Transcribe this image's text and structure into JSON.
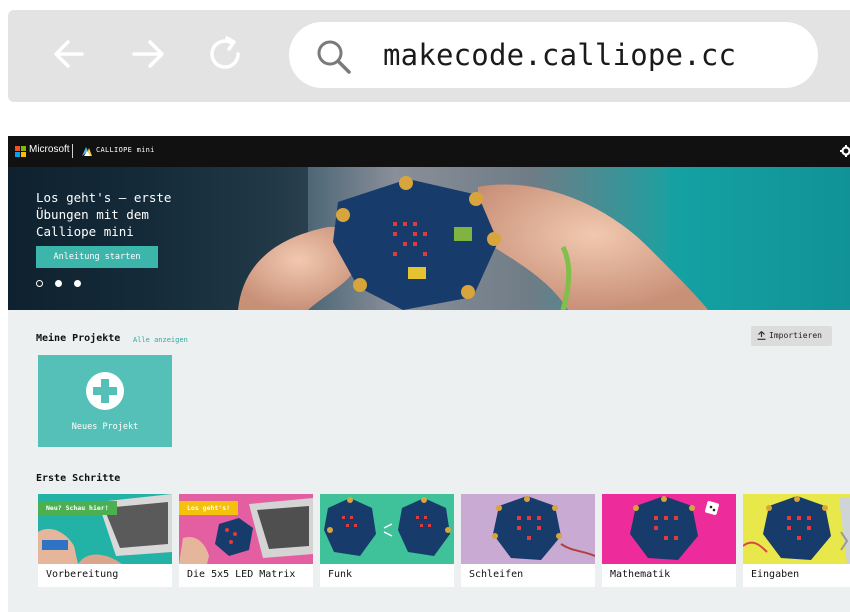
{
  "browser": {
    "url": "makecode.calliope.cc",
    "icons": [
      "back-arrow-icon",
      "forward-arrow-icon",
      "reload-icon",
      "search-icon"
    ]
  },
  "topbar": {
    "brand": "Microsoft",
    "product": "CALLIOPE mini",
    "icons": [
      "microsoft-logo-icon",
      "calliope-logo-icon",
      "gear-icon"
    ]
  },
  "hero": {
    "title_lines": [
      "Los geht's – erste",
      "Übungen mit dem",
      "Calliope mini"
    ],
    "button_label": "Anleitung starten",
    "slides_total": 3,
    "slide_active_index": 0
  },
  "projects": {
    "title": "Meine Projekte",
    "show_all": "Alle anzeigen",
    "import_label": "Importieren",
    "new_project_label": "Neues Projekt"
  },
  "getting_started": {
    "title": "Erste Schritte",
    "cards": [
      {
        "label": "Vorbereitung",
        "ribbon": "Neu? Schau hier!",
        "ribbon_color": "#4caf50"
      },
      {
        "label": "Die 5x5 LED Matrix",
        "ribbon": "Los geht's!",
        "ribbon_color": "#f4c20d"
      },
      {
        "label": "Funk",
        "ribbon": ""
      },
      {
        "label": "Schleifen",
        "ribbon": ""
      },
      {
        "label": "Mathematik",
        "ribbon": ""
      },
      {
        "label": "Eingaben",
        "ribbon": ""
      }
    ]
  },
  "colors": {
    "accent": "#3cb5ab",
    "topbar": "#111111",
    "page_bg": "#ecf0f1"
  }
}
